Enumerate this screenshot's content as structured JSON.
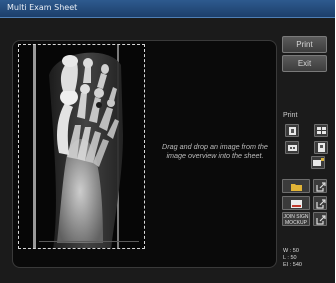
{
  "window": {
    "title": "Multi Exam Sheet"
  },
  "buttons": {
    "print": "Print",
    "exit": "Exit"
  },
  "sheet": {
    "drop_hint": "Drag and drop an image from the image overview into the sheet."
  },
  "xray": {
    "footer_left": "",
    "footer_mid": "",
    "footer_right": ""
  },
  "print_panel": {
    "label": "Print",
    "icons": [
      "print-layout-1x1-icon",
      "print-layout-grid-icon",
      "print-layout-2x1-icon",
      "print-portrait-icon",
      "print-landscape-icon"
    ]
  },
  "actions": [
    {
      "name": "open-folder-button",
      "icon": "folder-icon"
    },
    {
      "name": "save-image-button",
      "icon": "image-icon"
    },
    {
      "name": "join-sign-mockup-button",
      "label": "JOIN SIGN MOCKUP"
    }
  ],
  "readout": {
    "w": "W : 50",
    "l": "L : 50",
    "ei": "EI : 540"
  },
  "colors": {
    "titlebar": "#2e5a8e",
    "background": "#1b1b1b",
    "accent_folder": "#e2b437"
  }
}
